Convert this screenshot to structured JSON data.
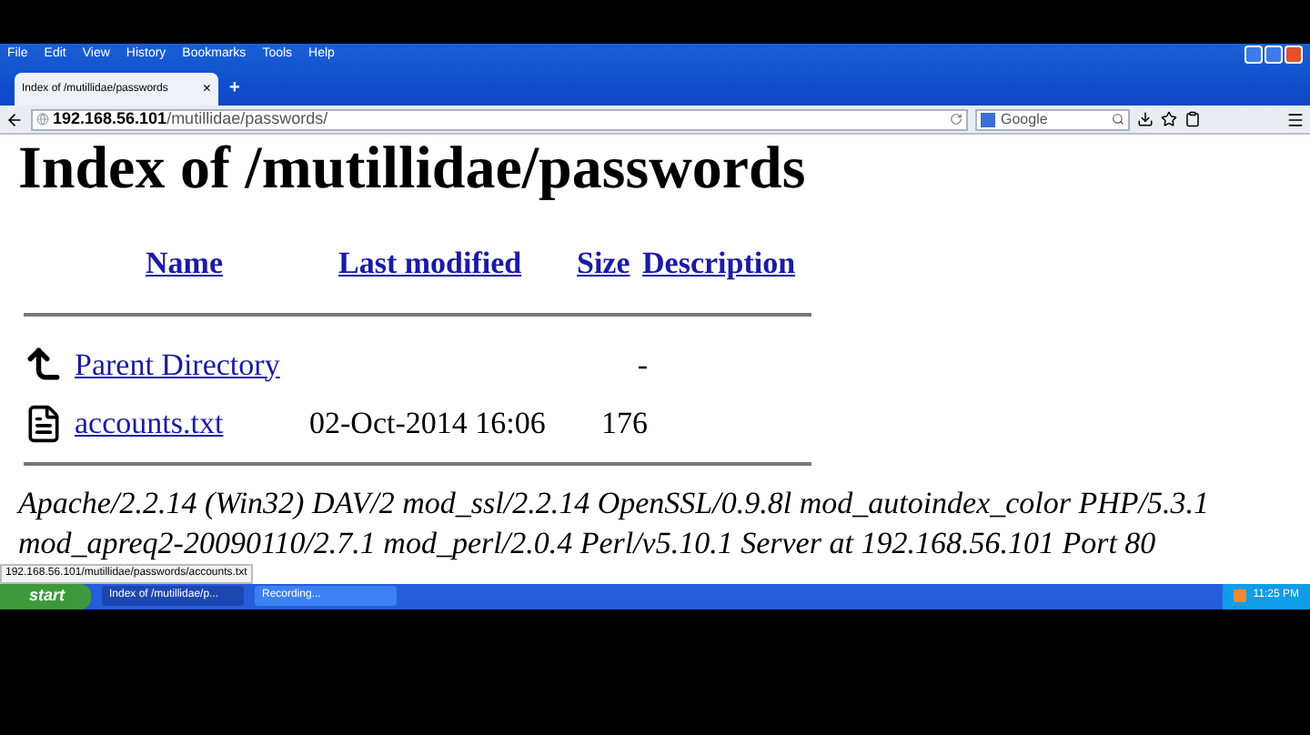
{
  "menu": [
    "File",
    "Edit",
    "View",
    "History",
    "Bookmarks",
    "Tools",
    "Help"
  ],
  "tabs": [
    {
      "label": "Index of /mutillidae/passwords",
      "close": "×",
      "selected": true
    }
  ],
  "new_tab": "+",
  "address": {
    "host": "192.168.56.101",
    "path": "/mutillidae/passwords/"
  },
  "search": {
    "placeholder": "Google"
  },
  "heading": "Index of /mutillidae/passwords",
  "columns": [
    "Name",
    "Last modified",
    "Size",
    "Description"
  ],
  "rows": [
    {
      "kind": "parent",
      "name": "Parent Directory",
      "modified": "",
      "size": "-"
    },
    {
      "kind": "file",
      "name": "accounts.txt",
      "modified": "02-Oct-2014 16:06",
      "size": "176"
    }
  ],
  "server": "Apache/2.2.14 (Win32) DAV/2 mod_ssl/2.2.14 OpenSSL/0.9.8l mod_autoindex_color PHP/5.3.1 mod_apreq2-20090110/2.7.1 mod_perl/2.0.4 Perl/v5.10.1 Server at 192.168.56.101 Port 80",
  "status_url": "192.168.56.101/mutillidae/passwords/accounts.txt",
  "taskbar": {
    "start": "start",
    "items": [
      {
        "label": "Index of /mutillidae/p...",
        "selected": true
      },
      {
        "label": "Recording...",
        "selected": false
      }
    ],
    "clock": "11:25 PM"
  }
}
